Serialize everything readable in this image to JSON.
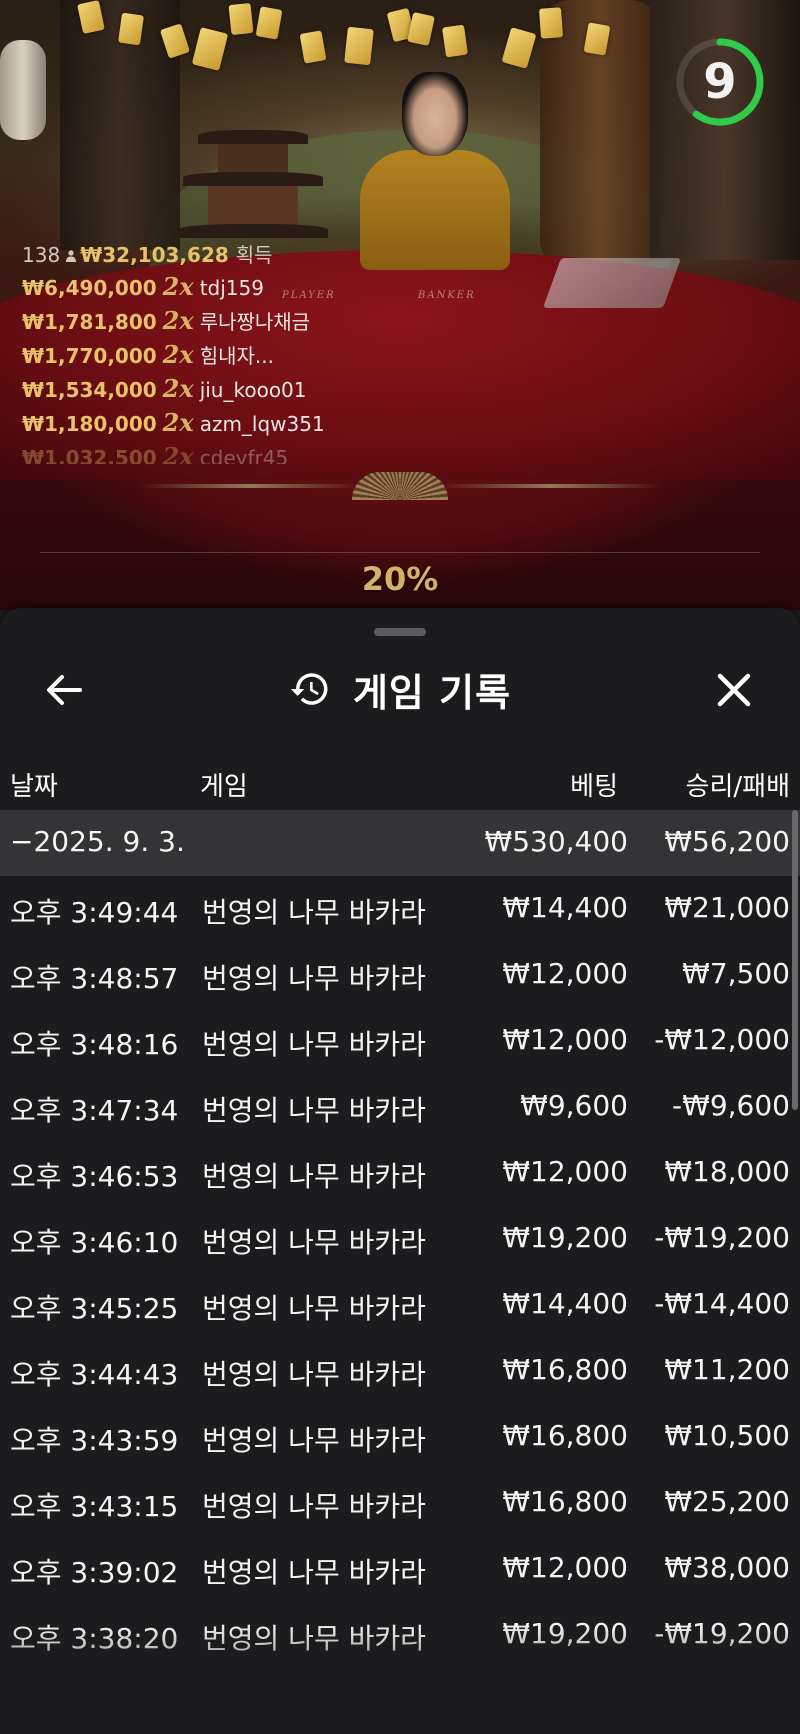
{
  "game_view": {
    "timer_value": "9",
    "timer_progress": 0.6,
    "timer_color": "#2ecc4a",
    "bottom_percent": "20%",
    "table_labels": {
      "player": "PLAYER",
      "banker": "BANKER"
    }
  },
  "winners": {
    "player_count": "138",
    "total_amount": "₩32,103,628",
    "total_suffix": "획득",
    "entries": [
      {
        "amount": "₩6,490,000",
        "multiplier": "2x",
        "name": "tdj159"
      },
      {
        "amount": "₩1,781,800",
        "multiplier": "2x",
        "name": "루나짱나채금"
      },
      {
        "amount": "₩1,770,000",
        "multiplier": "2x",
        "name": "힘내자..."
      },
      {
        "amount": "₩1,534,000",
        "multiplier": "2x",
        "name": "jiu_kooo01"
      },
      {
        "amount": "₩1,180,000",
        "multiplier": "2x",
        "name": "azm_lqw351"
      },
      {
        "amount": "₩1,032,500",
        "multiplier": "2x",
        "name": "cdeyfr45"
      }
    ]
  },
  "sheet": {
    "title": "게임 기록",
    "icons": {
      "back": "arrow-left-icon",
      "history": "history-icon",
      "close": "close-icon"
    },
    "columns": {
      "date": "날짜",
      "game": "게임",
      "bet": "베팅",
      "win_loss": "승리/패배"
    },
    "group": {
      "date": "−2025. 9. 3.",
      "bet": "₩530,400",
      "win_loss": "₩56,200"
    },
    "rows": [
      {
        "time": "오후 3:49:44",
        "game": "번영의 나무 바카라",
        "bet": "₩14,400",
        "win_loss": "₩21,000"
      },
      {
        "time": "오후 3:48:57",
        "game": "번영의 나무 바카라",
        "bet": "₩12,000",
        "win_loss": "₩7,500"
      },
      {
        "time": "오후 3:48:16",
        "game": "번영의 나무 바카라",
        "bet": "₩12,000",
        "win_loss": "-₩12,000"
      },
      {
        "time": "오후 3:47:34",
        "game": "번영의 나무 바카라",
        "bet": "₩9,600",
        "win_loss": "-₩9,600"
      },
      {
        "time": "오후 3:46:53",
        "game": "번영의 나무 바카라",
        "bet": "₩12,000",
        "win_loss": "₩18,000"
      },
      {
        "time": "오후 3:46:10",
        "game": "번영의 나무 바카라",
        "bet": "₩19,200",
        "win_loss": "-₩19,200"
      },
      {
        "time": "오후 3:45:25",
        "game": "번영의 나무 바카라",
        "bet": "₩14,400",
        "win_loss": "-₩14,400"
      },
      {
        "time": "오후 3:44:43",
        "game": "번영의 나무 바카라",
        "bet": "₩16,800",
        "win_loss": "₩11,200"
      },
      {
        "time": "오후 3:43:59",
        "game": "번영의 나무 바카라",
        "bet": "₩16,800",
        "win_loss": "₩10,500"
      },
      {
        "time": "오후 3:43:15",
        "game": "번영의 나무 바카라",
        "bet": "₩16,800",
        "win_loss": "₩25,200"
      },
      {
        "time": "오후 3:39:02",
        "game": "번영의 나무 바카라",
        "bet": "₩12,000",
        "win_loss": "₩38,000"
      },
      {
        "time": "오후 3:38:20",
        "game": "번영의 나무 바카라",
        "bet": "₩19,200",
        "win_loss": "-₩19,200"
      }
    ]
  }
}
